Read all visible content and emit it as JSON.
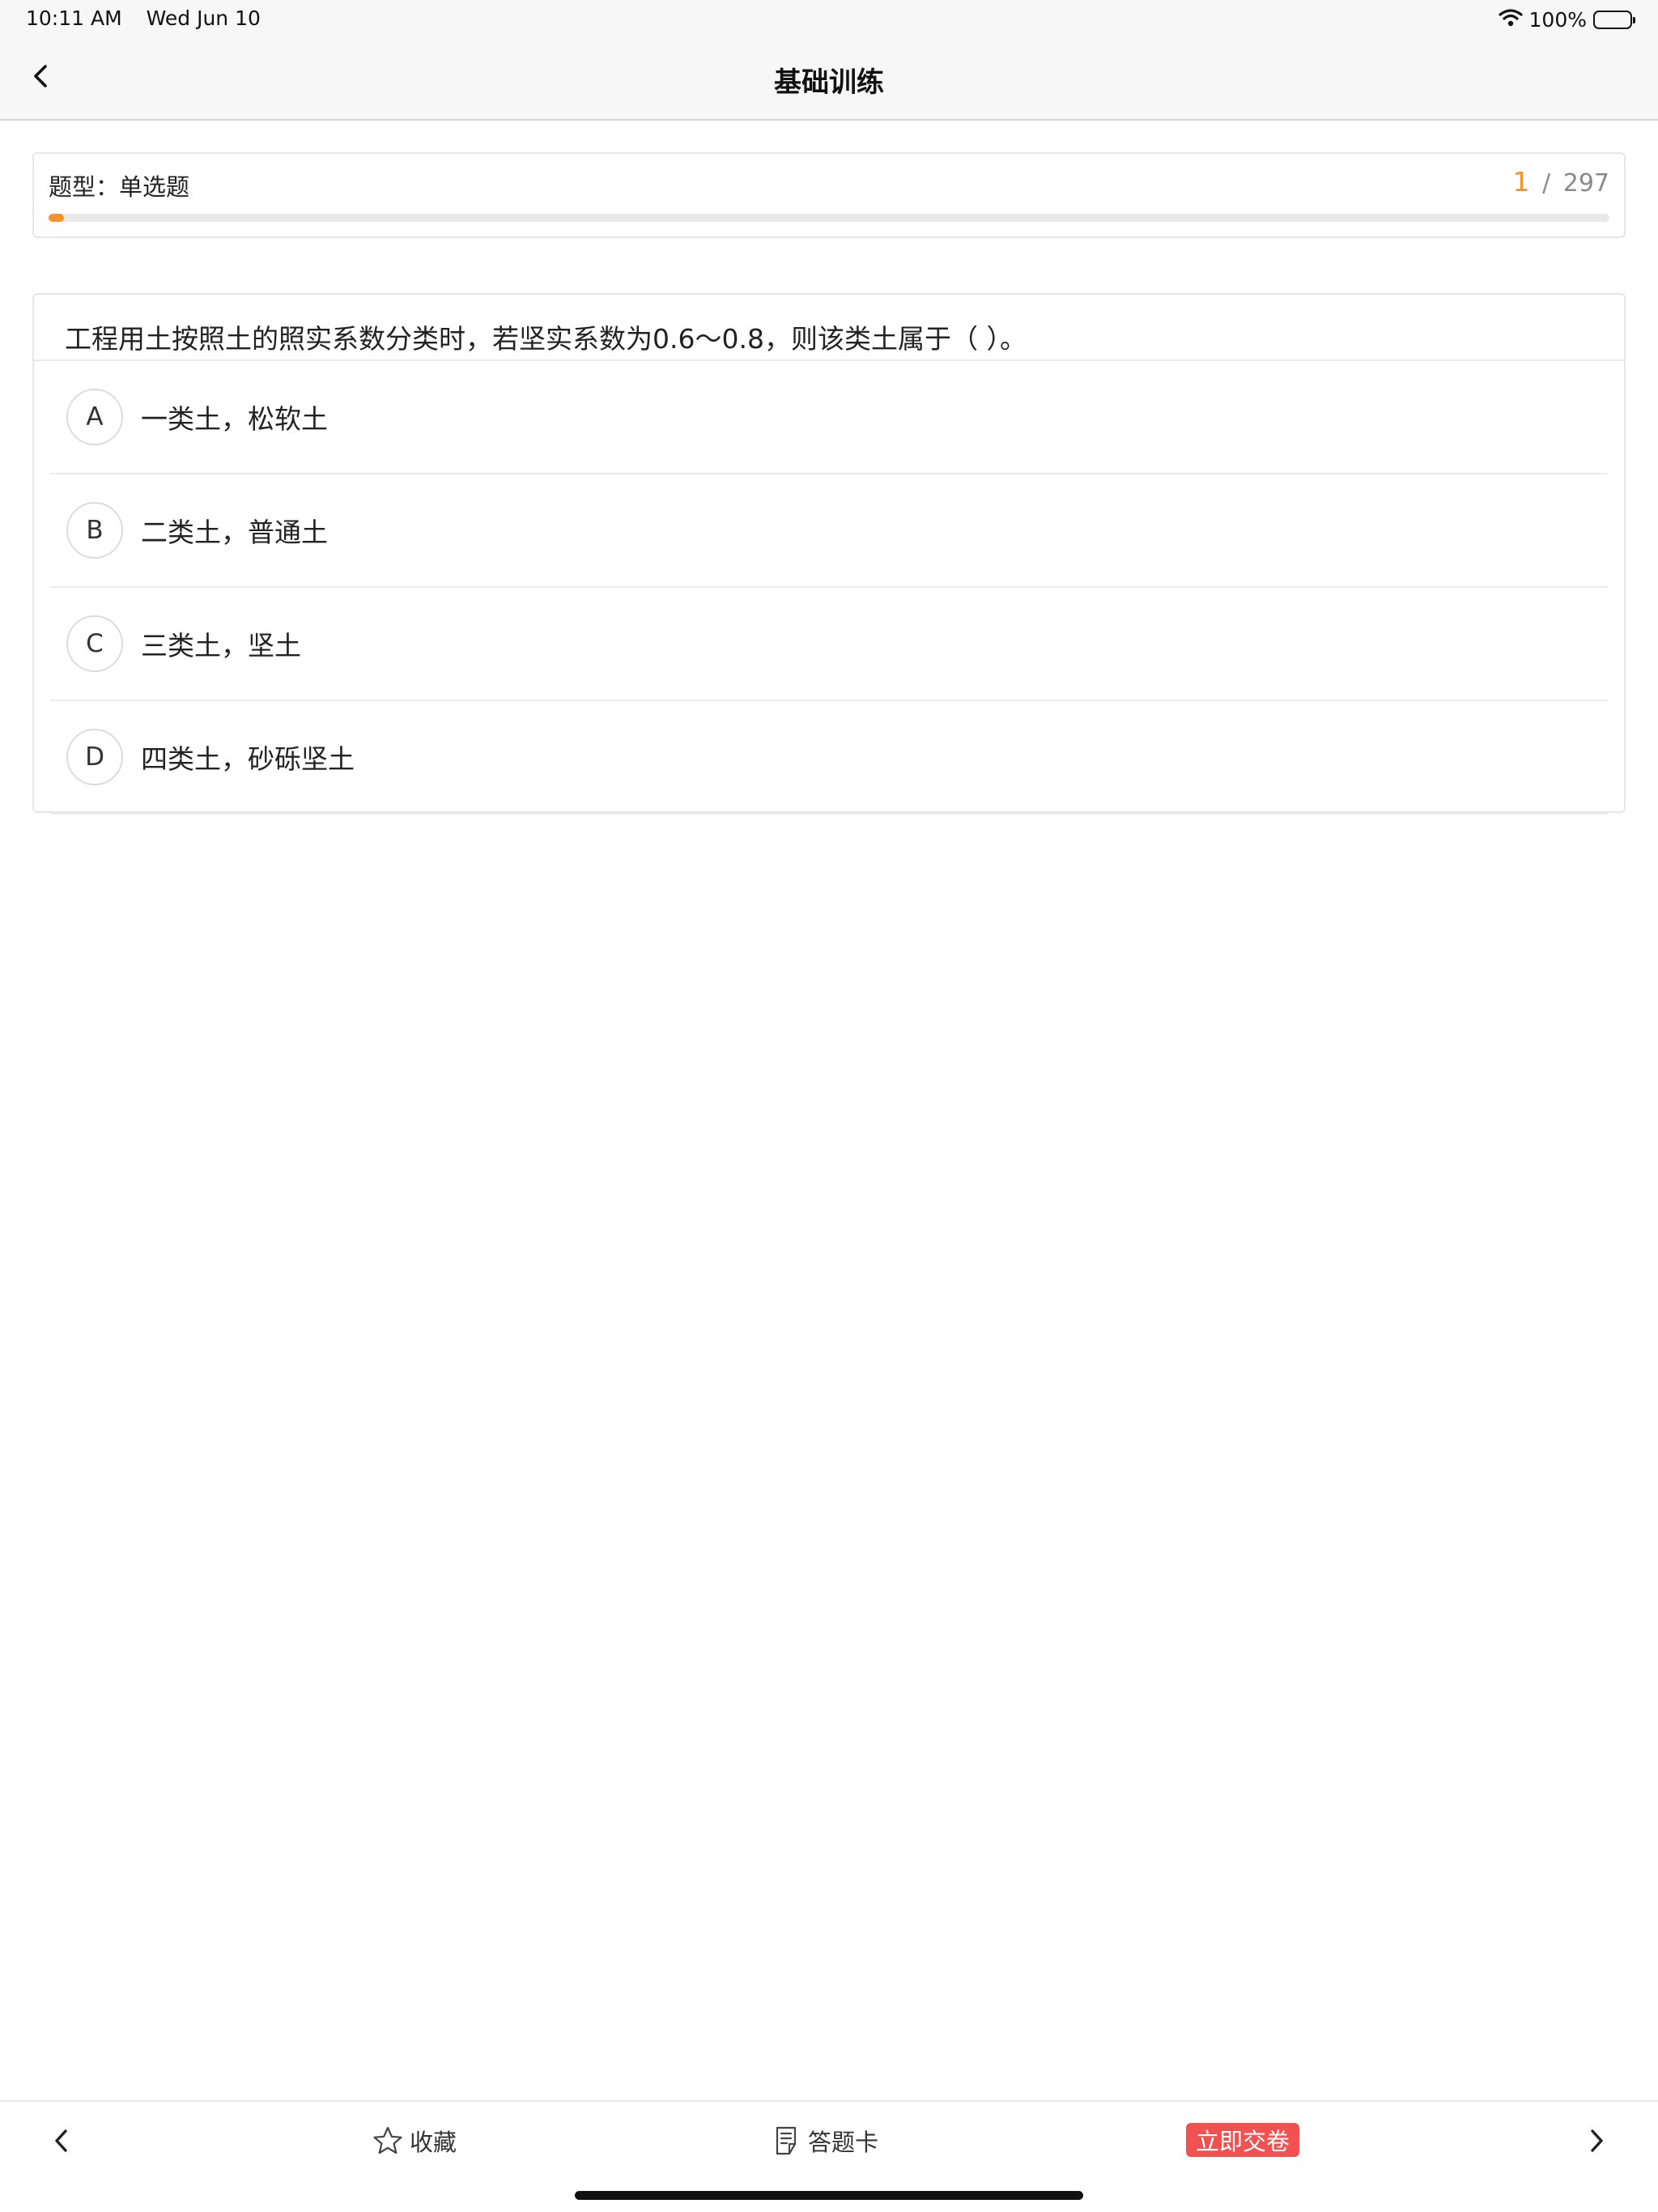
{
  "status_bar": {
    "time": "10:11 AM",
    "date": "Wed Jun 10",
    "battery": "100%"
  },
  "nav": {
    "title": "基础训练"
  },
  "quiz_info": {
    "type_label": "题型：单选题",
    "current": "1",
    "separator": "/",
    "total": "297",
    "progress": 0.01
  },
  "question": {
    "text": "工程用土按照土的照实系数分类时，若坚实系数为0.6～0.8，则该类土属于（ ）。",
    "options": [
      {
        "letter": "A",
        "text": "一类土，松软土"
      },
      {
        "letter": "B",
        "text": "二类土，普通土"
      },
      {
        "letter": "C",
        "text": "三类土，坚土"
      },
      {
        "letter": "D",
        "text": "四类土，砂砾坚土"
      }
    ]
  },
  "toolbar": {
    "favorite_label": "收藏",
    "answer_card_label": "答题卡",
    "submit_label": "立即交卷"
  },
  "colors": {
    "accent": "#f5922a",
    "submit": "#f05151"
  }
}
